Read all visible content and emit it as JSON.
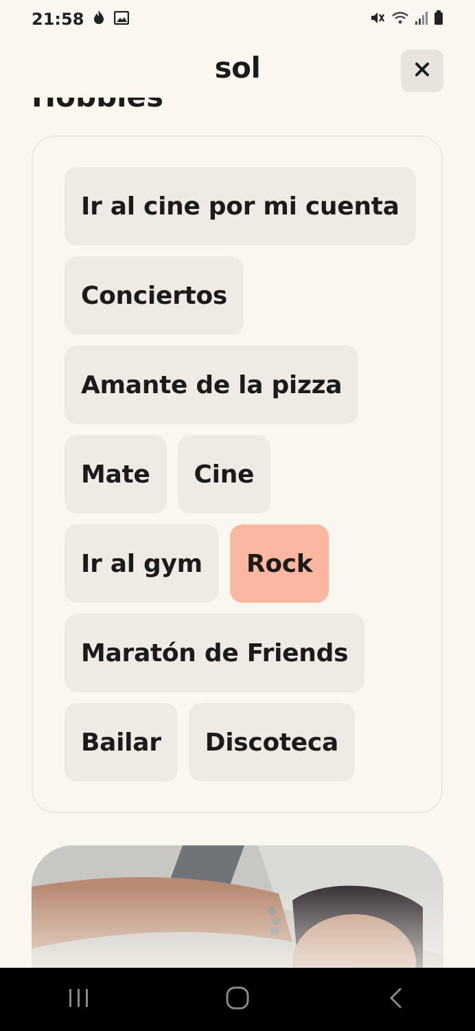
{
  "status_bar": {
    "time": "21:58",
    "left_icons": [
      "flame-icon",
      "image-icon"
    ],
    "right_icons": [
      "mute-vibrate-icon",
      "wifi-icon",
      "signal-icon",
      "battery-icon"
    ]
  },
  "header": {
    "title": "sol",
    "close_icon": "close-icon"
  },
  "section": {
    "title": "Hobbies"
  },
  "hobbies": [
    {
      "label": "Ir al cine por mi cuenta",
      "highlighted": false
    },
    {
      "label": "Conciertos",
      "highlighted": false
    },
    {
      "label": "Amante de la pizza",
      "highlighted": false
    },
    {
      "label": "Mate",
      "highlighted": false
    },
    {
      "label": "Cine",
      "highlighted": false
    },
    {
      "label": "Ir al gym",
      "highlighted": false
    },
    {
      "label": "Rock",
      "highlighted": true
    },
    {
      "label": "Maratón de Friends",
      "highlighted": false
    },
    {
      "label": "Bailar",
      "highlighted": false
    },
    {
      "label": "Discoteca",
      "highlighted": false
    }
  ],
  "colors": {
    "background": "#faf7f0",
    "chip": "#efebe4",
    "chip_highlighted": "#fcb7a0"
  },
  "nav_bar": {
    "icons": [
      "recent-apps-icon",
      "home-icon",
      "back-icon"
    ]
  }
}
